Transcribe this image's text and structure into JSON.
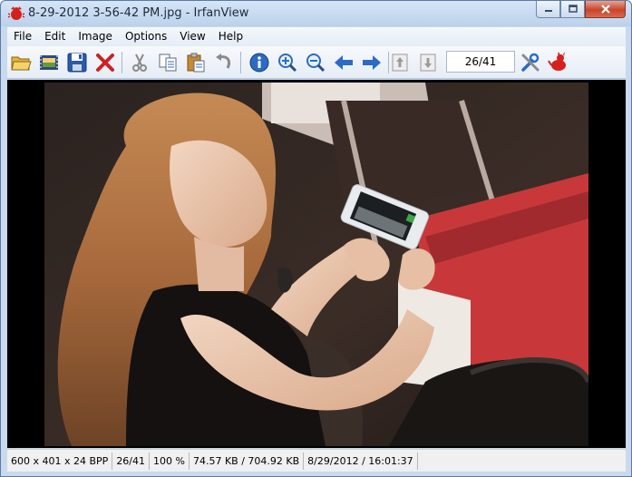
{
  "window": {
    "title": "8-29-2012 3-56-42 PM.jpg - IrfanView",
    "app_icon": "irfanview-red-cat-icon",
    "caption_buttons": [
      "minimize-icon",
      "maximize-icon",
      "close-icon"
    ]
  },
  "menu": {
    "items": [
      {
        "label": "File"
      },
      {
        "label": "Edit"
      },
      {
        "label": "Image"
      },
      {
        "label": "Options"
      },
      {
        "label": "View"
      },
      {
        "label": "Help"
      }
    ]
  },
  "toolbar": {
    "buttons": [
      {
        "name": "open-icon"
      },
      {
        "name": "slideshow-icon"
      },
      {
        "name": "save-icon"
      },
      {
        "name": "delete-icon"
      },
      {
        "name": "cut-icon"
      },
      {
        "name": "copy-icon"
      },
      {
        "name": "paste-icon"
      },
      {
        "name": "undo-icon"
      },
      {
        "name": "info-icon"
      },
      {
        "name": "zoom-in-icon"
      },
      {
        "name": "zoom-out-icon"
      },
      {
        "name": "previous-arrow-icon"
      },
      {
        "name": "next-arrow-icon"
      },
      {
        "name": "first-page-icon"
      },
      {
        "name": "last-page-icon"
      },
      {
        "name": "properties-tools-icon"
      },
      {
        "name": "irfanview-cat-icon"
      }
    ],
    "page_indicator": "26/41"
  },
  "image": {
    "content": "photo-woman-typing-on-smartphone"
  },
  "statusbar": {
    "dimensions": "600 x 401 x 24 BPP",
    "index": "26/41",
    "zoom": "100 %",
    "size": "74.57 KB / 704.92 KB",
    "datetime": "8/29/2012 / 16:01:37"
  },
  "colors": {
    "title_bar": "#c9d9ee",
    "accent_blue": "#2b6bc4",
    "delete_red": "#cc2222",
    "close_button_red": "#c9452a"
  }
}
